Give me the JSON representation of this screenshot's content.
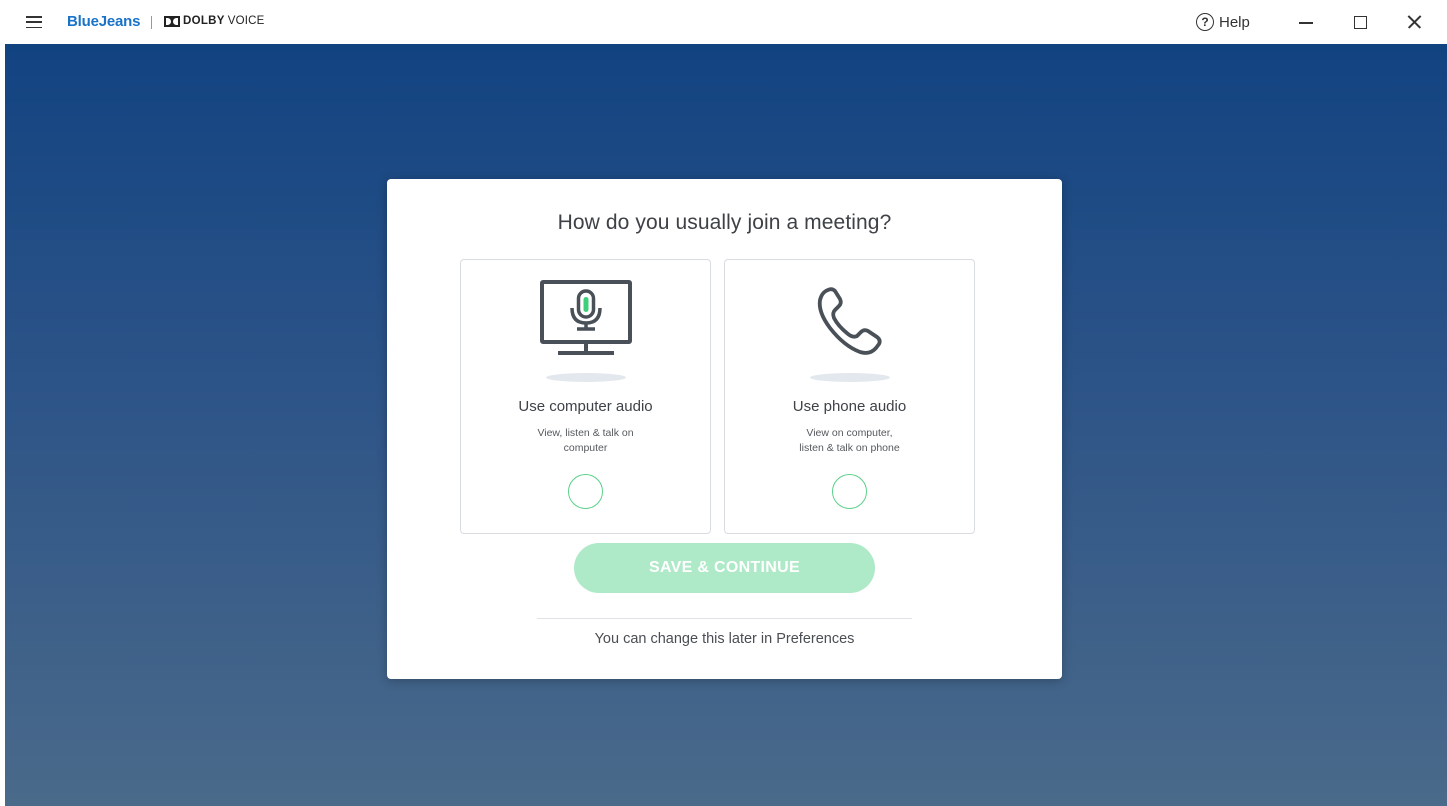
{
  "titlebar": {
    "brand": "BlueJeans",
    "partner_bold": "DOLBY",
    "partner_light": "VOICE",
    "help_label": "Help",
    "help_glyph": "?"
  },
  "dialog": {
    "title": "How do you usually join a meeting?",
    "options": [
      {
        "label": "Use computer audio",
        "desc_line1": "View, listen & talk on",
        "desc_line2": "computer",
        "icon": "monitor-microphone-icon"
      },
      {
        "label": "Use phone audio",
        "desc_line1": "View on computer,",
        "desc_line2": "listen & talk on phone",
        "icon": "phone-icon"
      }
    ],
    "save_label": "SAVE & CONTINUE",
    "note": "You can change this later in Preferences"
  },
  "colors": {
    "brand_blue": "#1a73c8",
    "accent_green": "#5bd08a",
    "button_disabled": "#aee9c8",
    "bg_top": "#124381",
    "bg_bottom": "#4a6a8a"
  }
}
